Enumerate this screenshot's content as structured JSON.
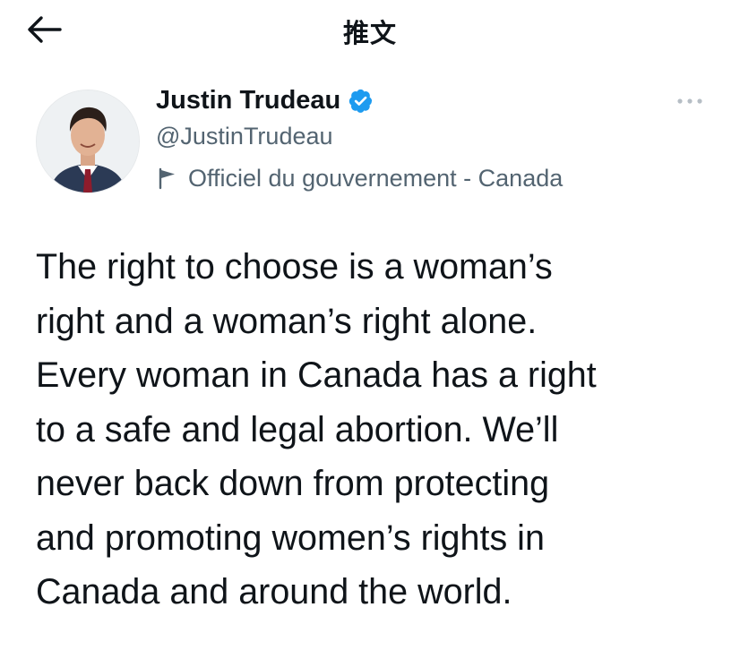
{
  "header": {
    "title": "推文",
    "back_icon": "arrow-left-icon"
  },
  "author": {
    "display_name": "Justin Trudeau",
    "handle": "@JustinTrudeau",
    "verified_icon": "verified-badge-icon",
    "verified_color": "#1d9bf0",
    "label_icon": "flag-icon",
    "label": "Officiel du gouvernement - Canada"
  },
  "tweet": {
    "text": "The right to choose is a woman’s\nright and a woman’s right alone.\nEvery woman in Canada has a right\nto a safe and legal abortion. We’ll\nnever back down from protecting\nand promoting women’s rights in\nCanada and around the world."
  },
  "colors": {
    "text_primary": "#0f1419",
    "text_secondary": "#536471",
    "accent": "#1d9bf0"
  }
}
